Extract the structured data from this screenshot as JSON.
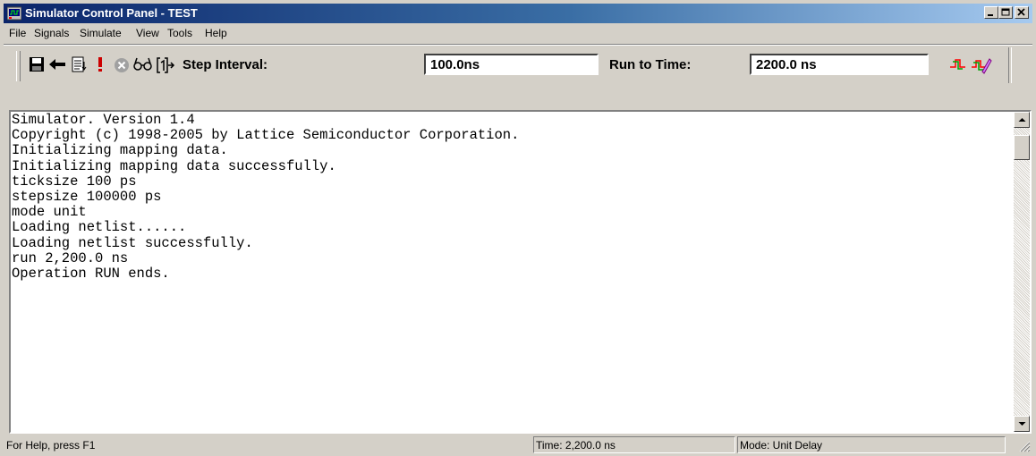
{
  "window": {
    "title": "Simulator Control Panel - TEST",
    "accent_color": "#0a246a"
  },
  "menu": [
    "File",
    "Signals",
    "Simulate",
    "View",
    "Tools",
    "Help"
  ],
  "toolbar": {
    "icons": [
      "save-icon",
      "back-arrow-icon",
      "list-icon",
      "exclamation-icon",
      "stop-icon",
      "glasses-icon",
      "step-icon",
      "signal-red-icon",
      "signal-edit-icon"
    ],
    "step_interval_label": "Step Interval:",
    "step_interval_value": "100.0ns",
    "run_to_time_label": "Run to Time:",
    "run_to_time_value": "2200.0 ns"
  },
  "console": {
    "lines": [
      "Simulator. Version 1.4",
      "Copyright (c) 1998-2005 by Lattice Semiconductor Corporation.",
      "Initializing mapping data.",
      "Initializing mapping data successfully.",
      "ticksize 100 ps",
      "stepsize 100000 ps",
      "mode unit",
      "Loading netlist......",
      "Loading netlist successfully.",
      "run 2,200.0 ns",
      "Operation RUN ends."
    ]
  },
  "status": {
    "help": "For Help, press F1",
    "time": "Time: 2,200.0 ns",
    "mode": "Mode: Unit Delay"
  }
}
